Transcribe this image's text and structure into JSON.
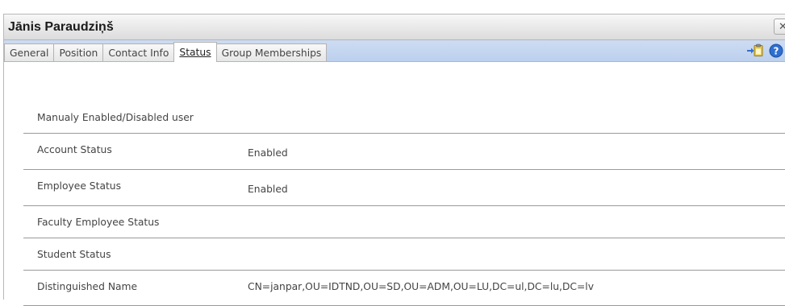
{
  "window": {
    "title": "Jānis Paraudziņš",
    "close_label": "✕"
  },
  "tabs": [
    {
      "label": "General",
      "active": false
    },
    {
      "label": "Position",
      "active": false
    },
    {
      "label": "Contact Info",
      "active": false
    },
    {
      "label": "Status",
      "active": true
    },
    {
      "label": "Group Memberships",
      "active": false
    }
  ],
  "toolbar": {
    "icons": [
      "export-arrow-icon",
      "clipboard-icon",
      "help-icon"
    ],
    "accent_blue": "#2e6fd1",
    "clipboard_yellow": "#e9c93a"
  },
  "status": {
    "rows": [
      {
        "label": "Manualy Enabled/Disabled user",
        "value": ""
      },
      {
        "label": "Account Status",
        "value": "Enabled"
      },
      {
        "label": "Employee Status",
        "value": "Enabled"
      },
      {
        "label": "Faculty Employee Status",
        "value": ""
      },
      {
        "label": "Student Status",
        "value": ""
      },
      {
        "label": "Distinguished Name",
        "value": "CN=janpar,OU=IDTND,OU=SD,OU=ADM,OU=LU,DC=ul,DC=lu,DC=lv"
      }
    ]
  }
}
